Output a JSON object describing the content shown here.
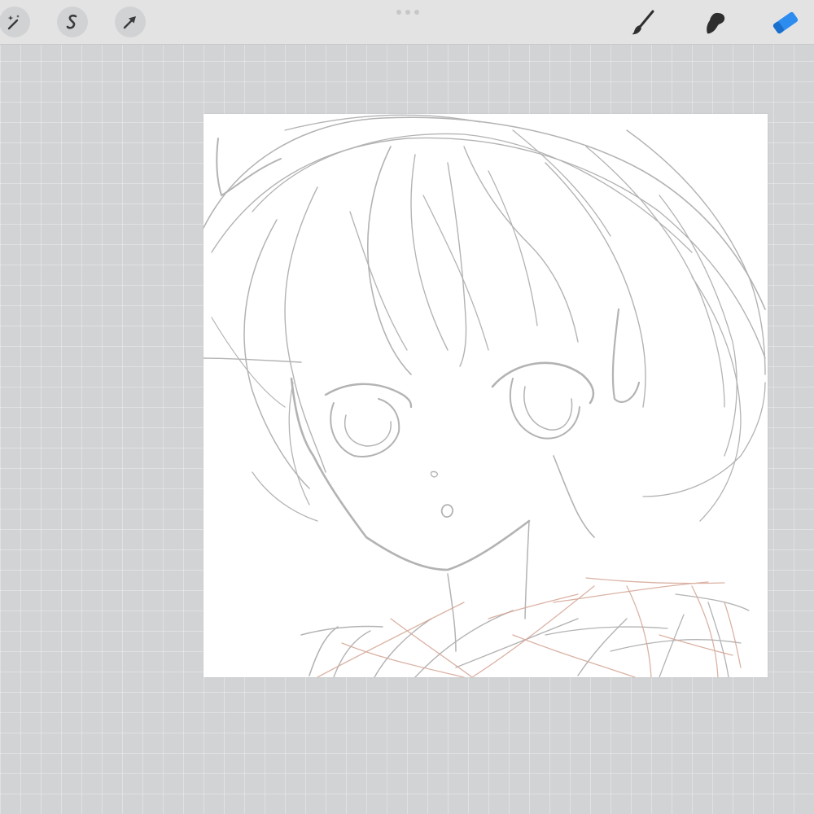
{
  "toolbar": {
    "left_tools": [
      {
        "name": "adjustments",
        "icon": "magic-wand-icon"
      },
      {
        "name": "selection",
        "icon": "selection-s-icon"
      },
      {
        "name": "transform",
        "icon": "arrow-cursor-icon"
      }
    ],
    "right_tools": [
      {
        "name": "brush",
        "icon": "brush-icon",
        "active": false
      },
      {
        "name": "smudge",
        "icon": "smudge-icon",
        "active": false
      },
      {
        "name": "eraser",
        "icon": "eraser-icon",
        "active": true
      }
    ],
    "accent_color": "#2d8cf0"
  },
  "canvas": {
    "background": "#ffffff",
    "sketch_color": "#9a9a9a",
    "secondary_sketch_color": "#d4a595"
  }
}
